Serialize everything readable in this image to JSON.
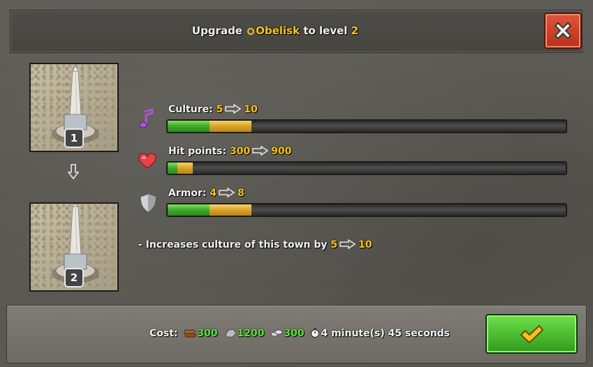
{
  "header": {
    "title_prefix": "Upgrade",
    "building_name": "Obelisk",
    "title_mid": "to level",
    "target_level": "2"
  },
  "images": {
    "current_level": "1",
    "next_level": "2"
  },
  "stats": [
    {
      "label": "Culture:",
      "current": "5",
      "next": "10",
      "icon": "music-note-icon",
      "current_fill": 0.105,
      "next_fill": 0.21
    },
    {
      "label": "Hit points:",
      "current": "300",
      "next": "900",
      "icon": "heart-icon",
      "current_fill": 0.024,
      "next_fill": 0.063
    },
    {
      "label": "Armor:",
      "current": "4",
      "next": "8",
      "icon": "shield-icon",
      "current_fill": 0.105,
      "next_fill": 0.21
    }
  ],
  "description": {
    "text": "- Increases culture of this town by",
    "current": "5",
    "next": "10"
  },
  "footer": {
    "cost_label": "Cost:",
    "wood": "300",
    "stone": "1200",
    "silver": "300",
    "time": "4 minute(s) 45 seconds"
  },
  "colors": {
    "accent_gold": "#f6c319",
    "resource_green": "#59e23f",
    "bar_current": "#3ea82a",
    "bar_next": "#d9a327",
    "close_red": "#c8392a",
    "confirm_green": "#46b52b"
  }
}
